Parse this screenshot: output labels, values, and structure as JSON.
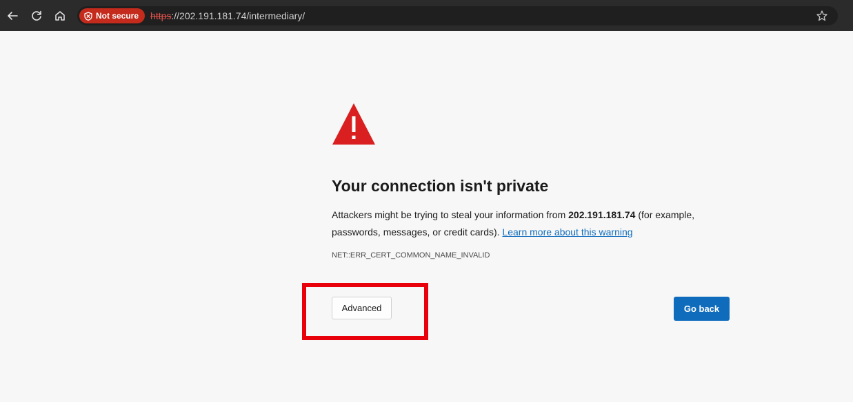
{
  "browser": {
    "security_chip_label": "Not secure",
    "url_scheme": "https",
    "url_rest": "://202.191.181.74/intermediary/",
    "icons": {
      "back": "back-arrow-icon",
      "refresh": "refresh-icon",
      "home": "home-icon",
      "security": "shield-warning-icon",
      "favorite": "star-icon"
    }
  },
  "page": {
    "title": "Your connection isn't private",
    "body_part1": "Attackers might be trying to steal your information from ",
    "host": "202.191.181.74",
    "body_part2": " (for example, passwords, messages, or credit cards). ",
    "learn_more_link": "Learn more about this warning",
    "error_code": "NET::ERR_CERT_COMMON_NAME_INVALID",
    "advanced_button": "Advanced",
    "go_back_button": "Go back"
  },
  "colors": {
    "warning_red": "#d91f1f",
    "primary_blue": "#0f6cbd",
    "highlight_red": "#e8000b",
    "not_secure_chip": "#c42b1c"
  }
}
